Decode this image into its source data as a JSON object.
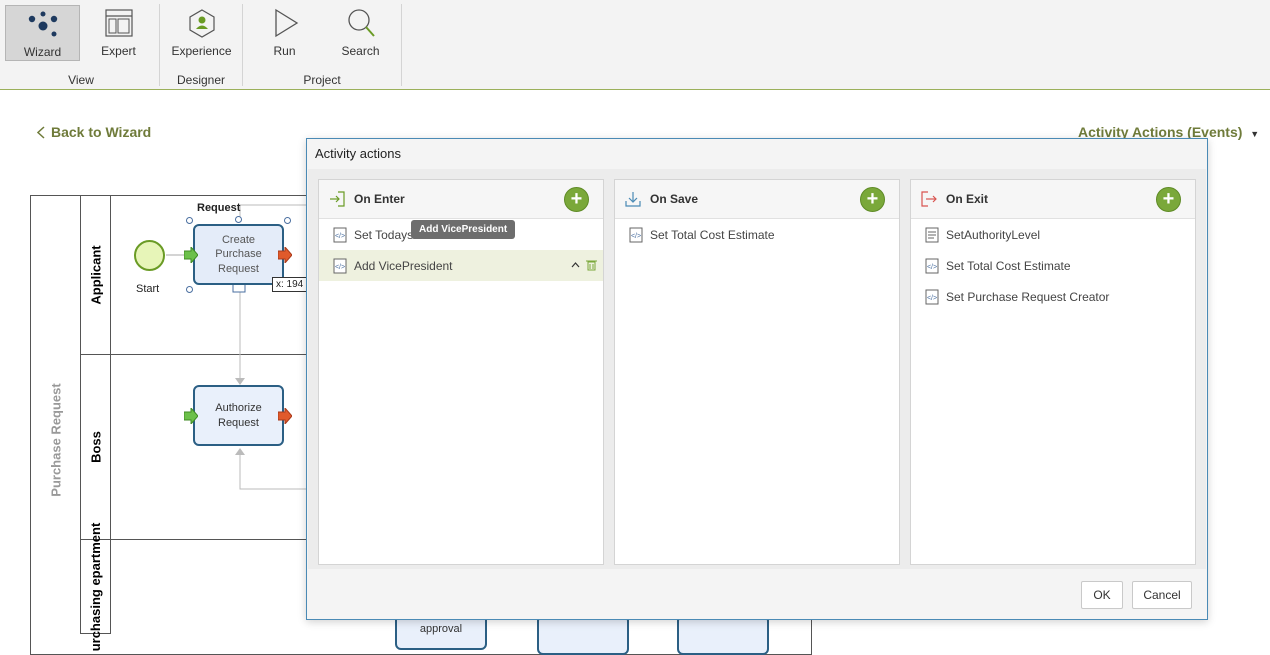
{
  "ribbon": {
    "buttons": [
      {
        "label": "Wizard",
        "icon": "wizard-icon",
        "active": true
      },
      {
        "label": "Expert",
        "icon": "expert-icon"
      },
      {
        "label": "Experience",
        "icon": "experience-icon"
      },
      {
        "label": "Run",
        "icon": "play-icon"
      },
      {
        "label": "Search",
        "icon": "search-icon"
      }
    ],
    "groups": [
      "View",
      "Designer",
      "Project"
    ]
  },
  "page": {
    "back_label": "Back to Wizard",
    "activity_actions_label": "Activity Actions (Events)"
  },
  "diagram": {
    "pool_label": "Purchase Request",
    "lanes": [
      "Applicant",
      "Boss",
      "urchasing epartment"
    ],
    "start_label": "Start",
    "request_label": "Request",
    "tasks": [
      "Create Purchase Request",
      "Authorize Request",
      "approval"
    ],
    "coord_readout": "x: 194"
  },
  "dialog": {
    "title": "Activity actions",
    "tooltip": "Add VicePresident",
    "panels": [
      {
        "title": "On Enter",
        "icon": "enter-icon",
        "items": [
          {
            "label": "Set Todays D",
            "icon": "script-icon"
          },
          {
            "label": "Add VicePresident",
            "icon": "script-icon",
            "selected": true
          }
        ]
      },
      {
        "title": "On Save",
        "icon": "save-icon",
        "items": [
          {
            "label": "Set Total Cost Estimate",
            "icon": "script-icon"
          }
        ]
      },
      {
        "title": "On Exit",
        "icon": "exit-icon",
        "items": [
          {
            "label": "SetAuthorityLevel",
            "icon": "rule-icon"
          },
          {
            "label": "Set Total Cost Estimate",
            "icon": "script-icon"
          },
          {
            "label": "Set Purchase Request Creator",
            "icon": "script-icon"
          }
        ]
      }
    ],
    "ok_label": "OK",
    "cancel_label": "Cancel"
  },
  "colors": {
    "accent_green": "#7aa83a",
    "link_olive": "#6f7b3a",
    "task_border": "#2b5f84",
    "dialog_border": "#4a8ab5"
  }
}
